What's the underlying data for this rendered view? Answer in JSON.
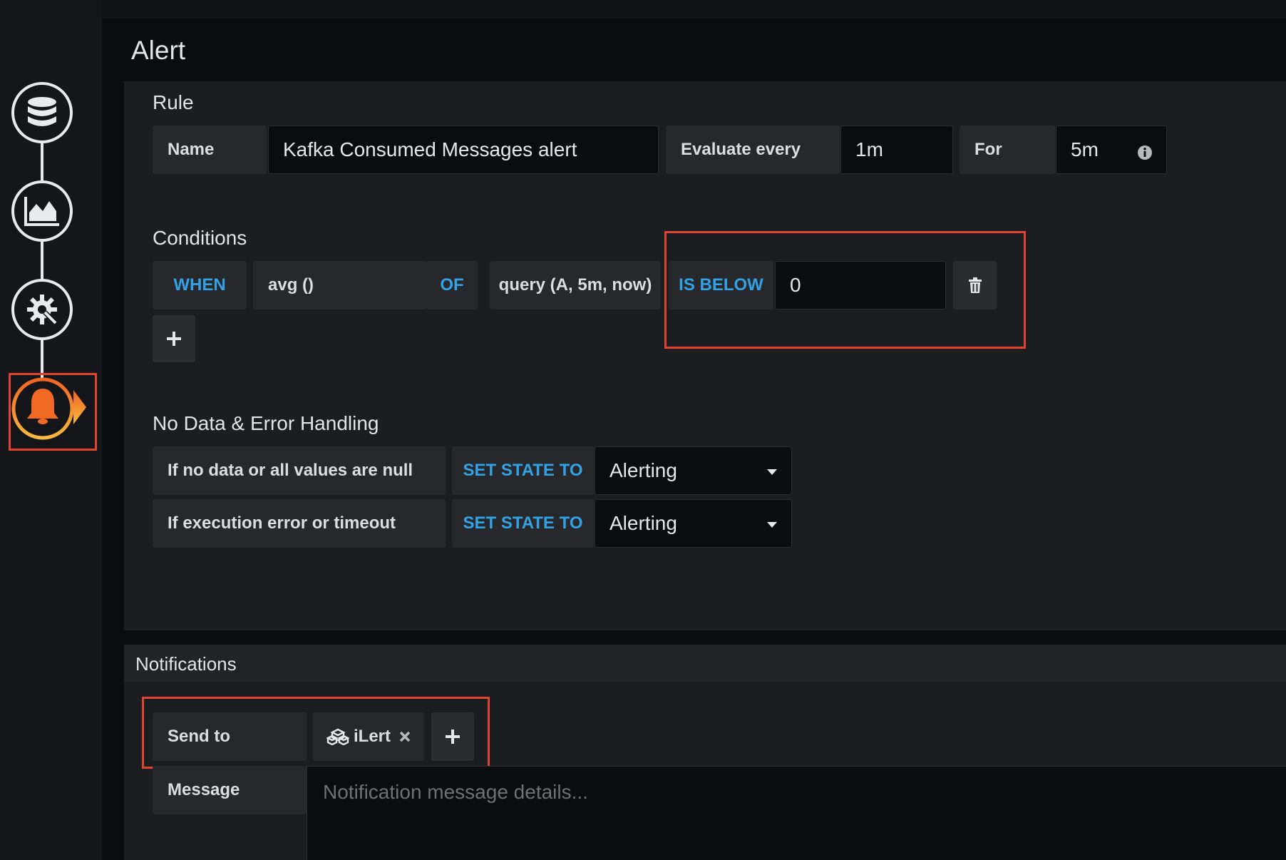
{
  "header": {
    "title": "Alert"
  },
  "sidebar": {
    "steps": [
      {
        "name": "data-source-icon"
      },
      {
        "name": "visualization-icon"
      },
      {
        "name": "settings-icon"
      },
      {
        "name": "alert-bell-icon"
      }
    ]
  },
  "rule": {
    "section_title": "Rule",
    "name_label": "Name",
    "name_value": "Kafka Consumed Messages alert",
    "evaluate_label": "Evaluate every",
    "evaluate_value": "1m",
    "for_label": "For",
    "for_value": "5m"
  },
  "conditions": {
    "section_title": "Conditions",
    "when_label": "WHEN",
    "reducer": "avg ()",
    "of_label": "OF",
    "query": "query (A, 5m, now)",
    "evaluator": "IS BELOW",
    "threshold": "0"
  },
  "nodata": {
    "section_title": "No Data & Error Handling",
    "rows": [
      {
        "label": "If no data or all values are null",
        "set_state_label": "SET STATE TO",
        "value": "Alerting"
      },
      {
        "label": "If execution error or timeout",
        "set_state_label": "SET STATE TO",
        "value": "Alerting"
      }
    ]
  },
  "notifications": {
    "title": "Notifications",
    "send_to_label": "Send to",
    "channel": "iLert",
    "message_label": "Message",
    "message_placeholder": "Notification message details..."
  },
  "colors": {
    "accent_blue": "#33a2e5",
    "highlight_red": "#e0432e",
    "alert_orange": "#f16a23"
  }
}
